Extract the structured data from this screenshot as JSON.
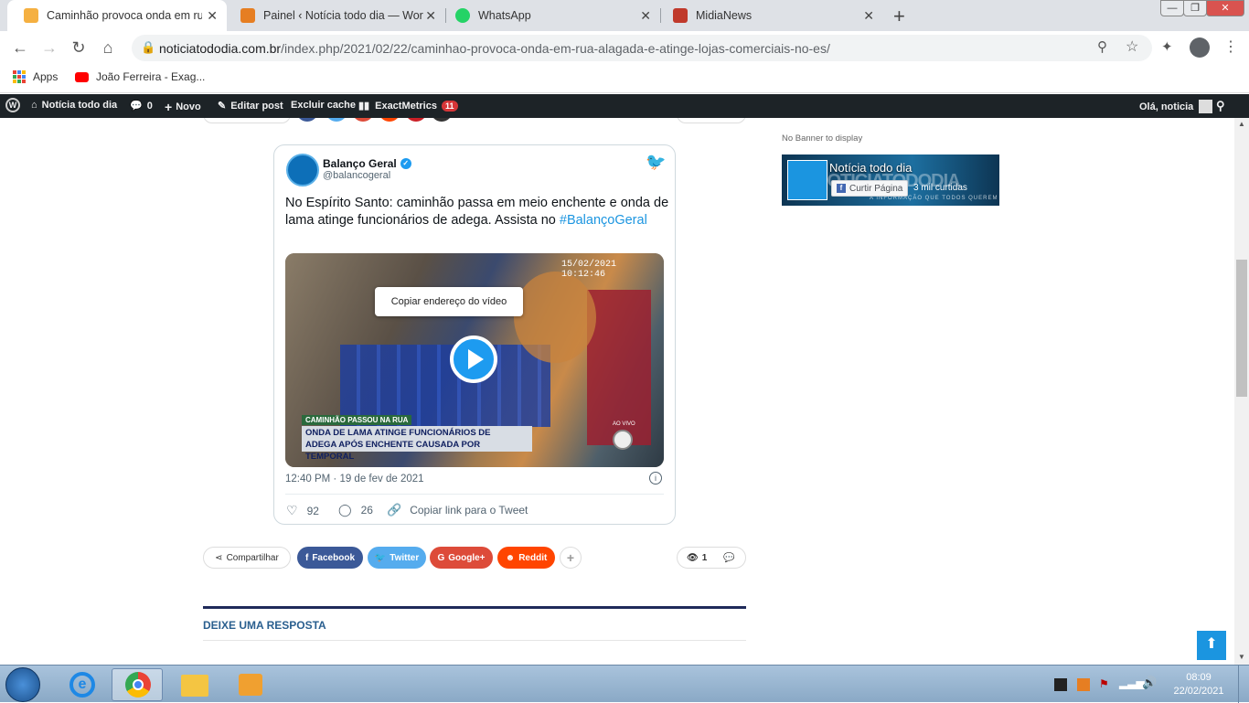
{
  "browser": {
    "tabs": [
      {
        "title": "Caminhão provoca onda em rua",
        "active": true
      },
      {
        "title": "Painel ‹ Notícia todo dia — Word",
        "active": false
      },
      {
        "title": "WhatsApp",
        "active": false
      },
      {
        "title": "MidiaNews",
        "active": false
      }
    ],
    "new_tab": "+",
    "window_controls": [
      "—",
      "❐",
      "✕"
    ],
    "url_domain": "noticiatododia.com.br",
    "url_path": "/index.php/2021/02/22/caminhao-provoca-onda-em-rua-alagada-e-atinge-lojas-comerciais-no-es/",
    "bookmarks": [
      "Apps",
      "João Ferreira - Exag..."
    ]
  },
  "wp_admin": {
    "site_name": "Notícia todo dia",
    "comments_count": "0",
    "new_label": "Novo",
    "edit_label": "Editar post",
    "cache_label": "Excluir cache",
    "metrics_label": "ExactMetrics",
    "metrics_badge": "11",
    "greeting": "Olá, noticia"
  },
  "tweet": {
    "author": "Balanço Geral",
    "handle": "@balancogeral",
    "text": "No Espírito Santo: caminhão passa em meio enchente e onda de lama atinge funcionários de adega. Assista no ",
    "hashtag": "#BalançoGeral",
    "video_tooltip": "Copiar endereço do vídeo",
    "video_timestamp": "15/02/2021 10:12:46",
    "video_tag": "CAMINHÃO PASSOU NA RUA",
    "video_caption_line1": "ONDA DE LAMA ATINGE FUNCIONÁRIOS DE",
    "video_caption_line2": "ADEGA APÓS ENCHENTE CAUSADA POR TEMPORAL",
    "video_live": "AO VIVO",
    "posted": "12:40 PM · 19 de fev de 2021",
    "likes": "92",
    "replies": "26",
    "copy_link": "Copiar link para o Tweet"
  },
  "share": {
    "share_label": "Compartilhar",
    "facebook": "Facebook",
    "twitter": "Twitter",
    "google": "Google+",
    "reddit": "Reddit",
    "views": "1"
  },
  "reply_heading": "DEIXE UMA RESPOSTA",
  "sidebar": {
    "no_banner": "No Banner to display",
    "fb_page_name": "Notícia todo dia",
    "fb_like_label": "Curtir Página",
    "fb_likes": "3 mil curtidas",
    "fb_bg_text": "NOTICIATODODIA",
    "fb_tagline": "A INFORMAÇÃO QUE TODOS QUEREM"
  },
  "taskbar": {
    "time": "08:09",
    "date": "22/02/2021"
  },
  "colors": {
    "facebook": "#3b5998",
    "twitter": "#55acee",
    "google": "#dd4b39",
    "reddit": "#ff4500",
    "accent_blue": "#1b95e0",
    "heading_blue": "#2a5f8f"
  }
}
